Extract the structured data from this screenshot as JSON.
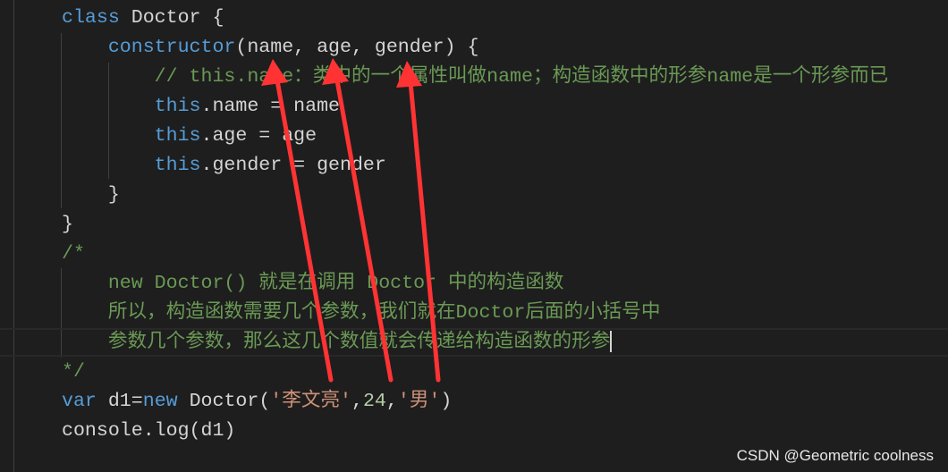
{
  "colors": {
    "background": "#1e1e1e",
    "keyword": "#569cd6",
    "text": "#d4d4d4",
    "comment": "#6a9955",
    "string": "#ce9178",
    "number": "#b5cea8",
    "annotation_arrow": "#ff3333"
  },
  "code_lines": [
    [
      {
        "t": "class ",
        "c": "kw"
      },
      {
        "t": "Doctor {",
        "c": "tx"
      }
    ],
    [
      {
        "t": "    "
      },
      {
        "t": "constructor",
        "c": "kw"
      },
      {
        "t": "(name, age, gender) {",
        "c": "tx"
      }
    ],
    [
      {
        "t": "        "
      },
      {
        "t": "// this.name：类中的一个属性叫做name；构造函数中的形参name是一个形参而已",
        "c": "cm"
      }
    ],
    [
      {
        "t": "        "
      },
      {
        "t": "this",
        "c": "kw"
      },
      {
        "t": ".name = name",
        "c": "tx"
      }
    ],
    [
      {
        "t": "        "
      },
      {
        "t": "this",
        "c": "kw"
      },
      {
        "t": ".age = age",
        "c": "tx"
      }
    ],
    [
      {
        "t": "        "
      },
      {
        "t": "this",
        "c": "kw"
      },
      {
        "t": ".gender = gender",
        "c": "tx"
      }
    ],
    [
      {
        "t": "    "
      },
      {
        "t": "}",
        "c": "tx"
      }
    ],
    [
      {
        "t": "}",
        "c": "tx"
      }
    ],
    [
      {
        "t": "/*",
        "c": "cm"
      }
    ],
    [
      {
        "t": "    "
      },
      {
        "t": "new Doctor() 就是在调用 Doctor 中的构造函数",
        "c": "cm"
      }
    ],
    [
      {
        "t": "    "
      },
      {
        "t": "所以，构造函数需要几个参数，我们就在Doctor后面的小括号中",
        "c": "cm"
      }
    ],
    [
      {
        "t": "    "
      },
      {
        "t": "参数几个参数，那么这几个数值就会传递给构造函数的形参",
        "c": "cm"
      }
    ],
    [
      {
        "t": "*/",
        "c": "cm"
      }
    ],
    [
      {
        "t": "var ",
        "c": "kw"
      },
      {
        "t": "d1=",
        "c": "tx"
      },
      {
        "t": "new ",
        "c": "kw"
      },
      {
        "t": "Doctor(",
        "c": "tx"
      },
      {
        "t": "'李文亮'",
        "c": "st"
      },
      {
        "t": ",",
        "c": "tx"
      },
      {
        "t": "24",
        "c": "nm"
      },
      {
        "t": ",",
        "c": "tx"
      },
      {
        "t": "'男'",
        "c": "st"
      },
      {
        "t": ")",
        "c": "tx"
      }
    ],
    [
      {
        "t": "console.log(d1)",
        "c": "tx"
      }
    ]
  ],
  "cursor_line": 11,
  "watermark": "CSDN @Geometric coolness"
}
